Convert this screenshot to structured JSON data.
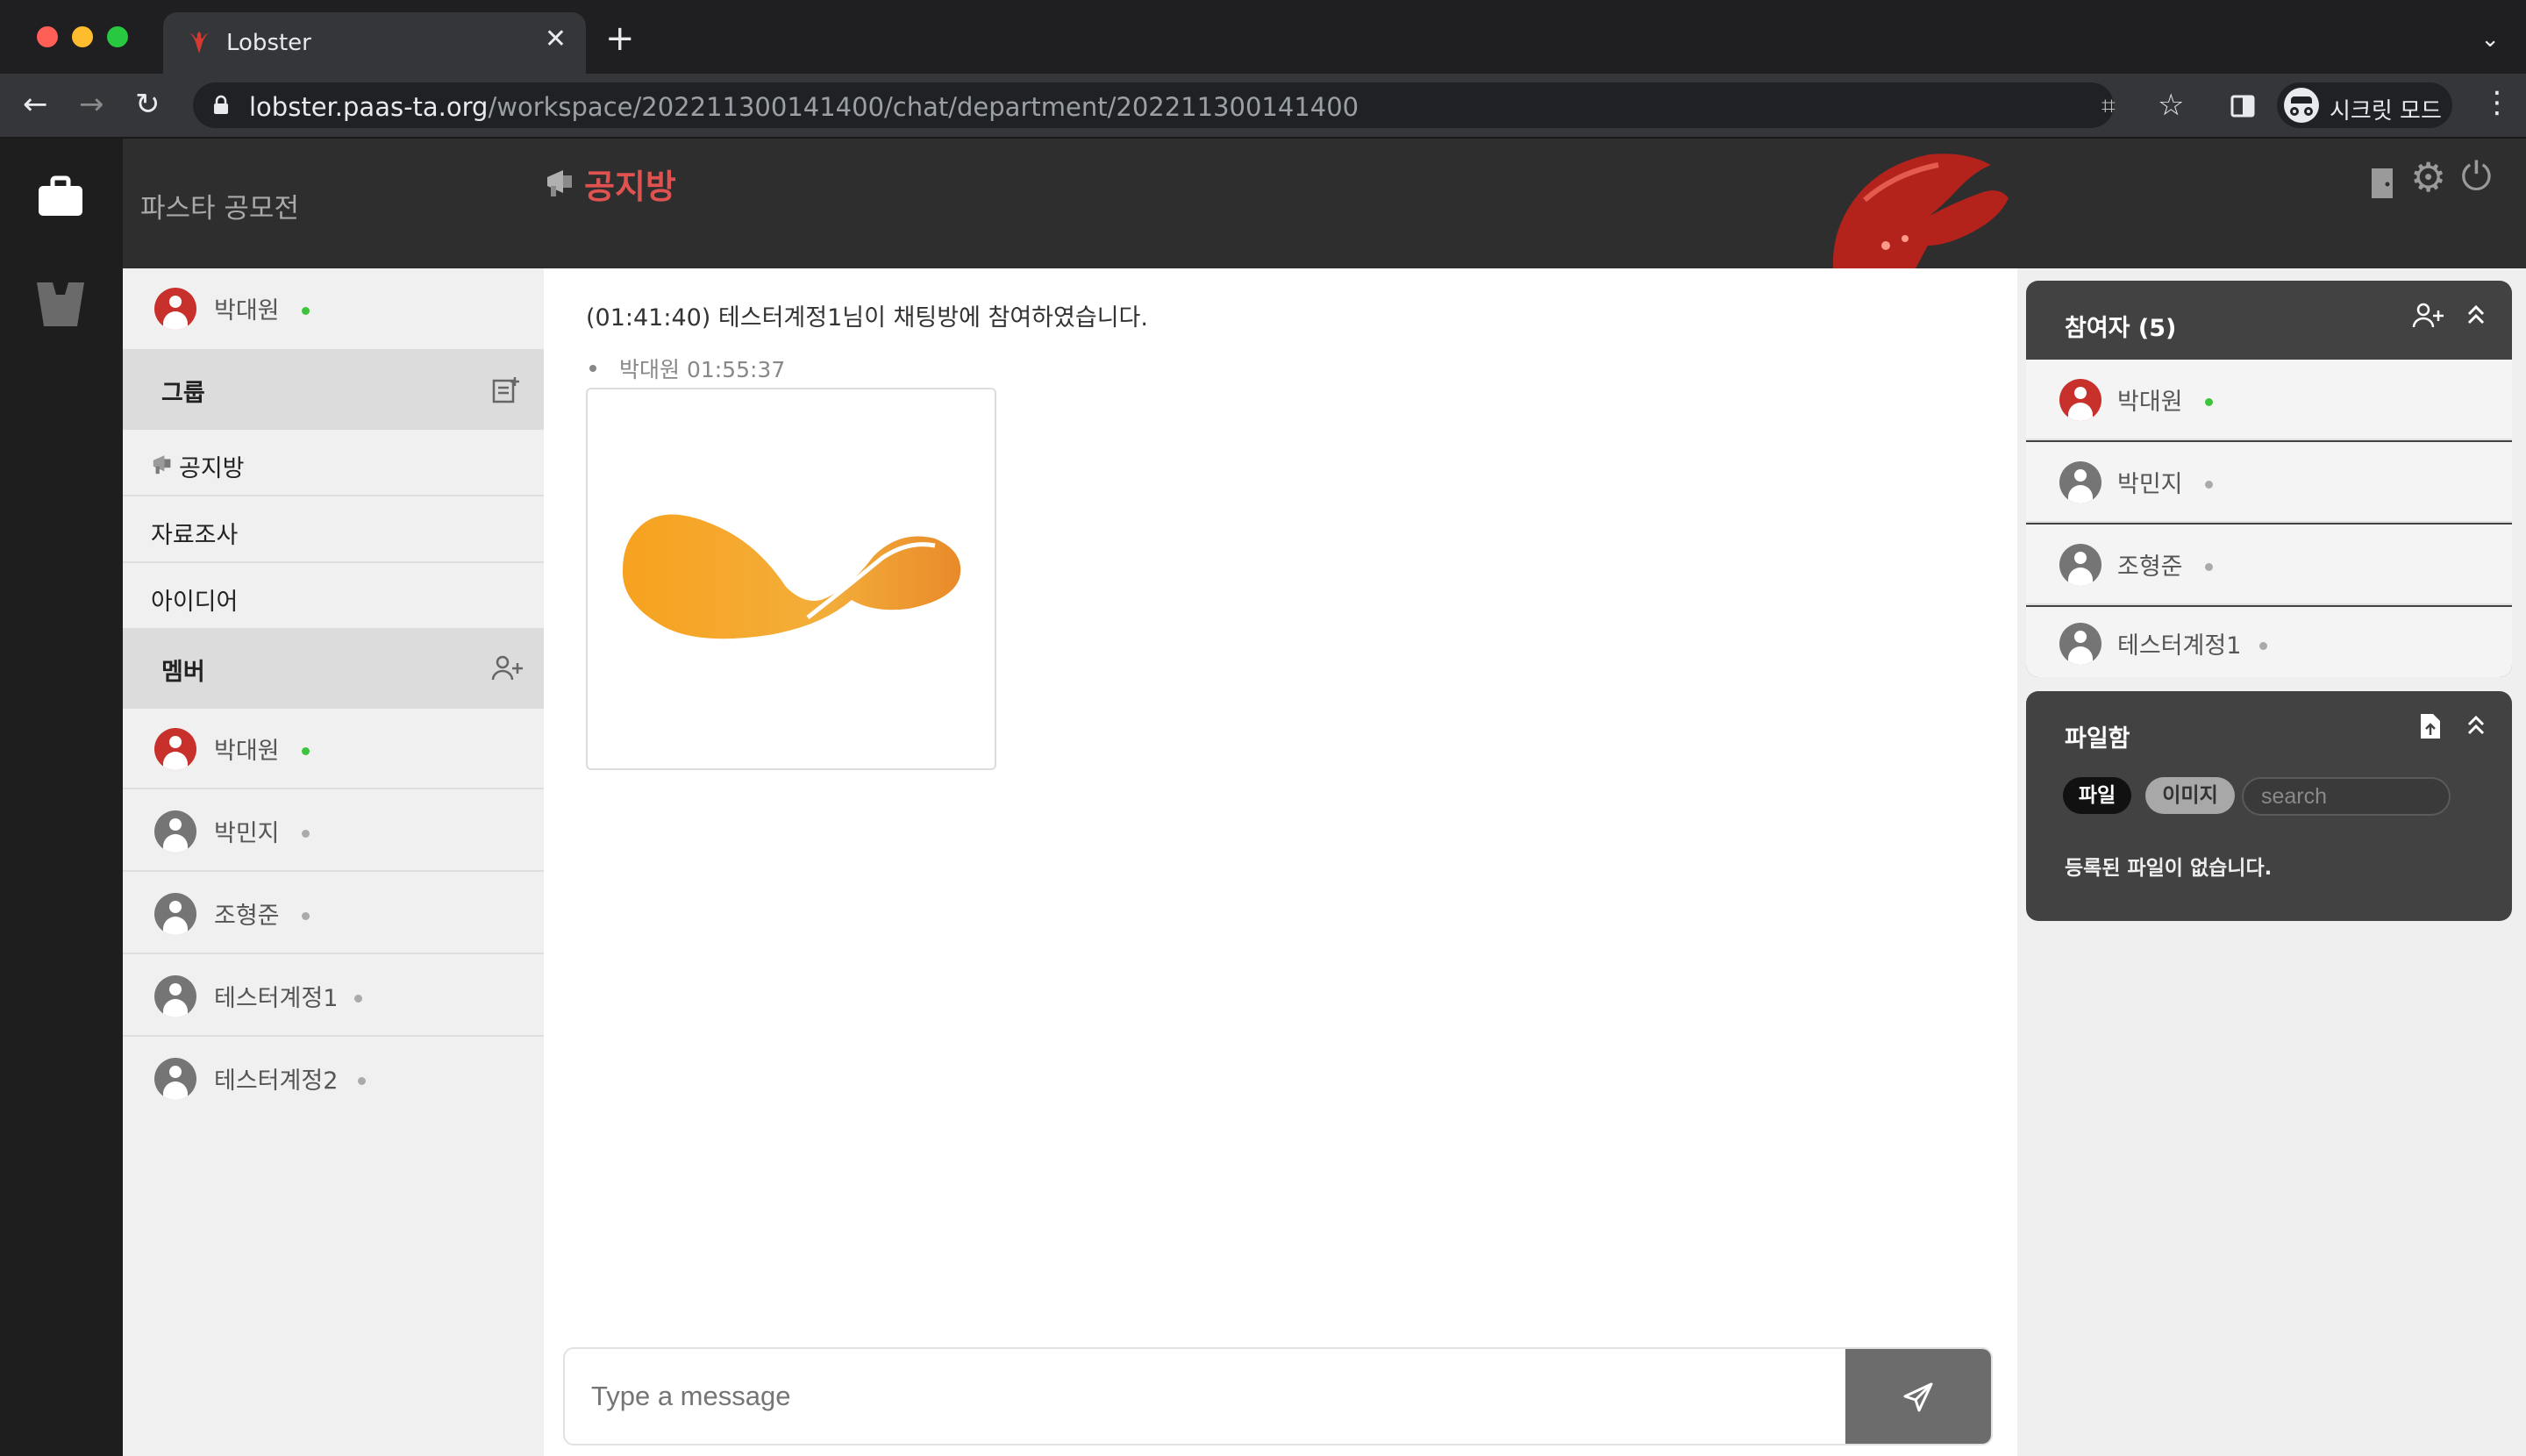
{
  "browser": {
    "tab_title": "Lobster",
    "url_host": "lobster.paas-ta.org",
    "url_path": "/workspace/202211300141400/chat/department/202211300141400",
    "incognito_label": "시크릿 모드"
  },
  "header": {
    "workspace_title": "파스타 공모전",
    "channel_title": "공지방"
  },
  "sidebar": {
    "current_user": {
      "name": "박대원",
      "online": true
    },
    "groups_label": "그룹",
    "groups": [
      {
        "label": "공지방",
        "icon": "megaphone-icon"
      },
      {
        "label": "자료조사"
      },
      {
        "label": "아이디어"
      }
    ],
    "members_label": "멤버",
    "members": [
      {
        "name": "박대원",
        "online": true
      },
      {
        "name": "박민지",
        "online": false
      },
      {
        "name": "조형준",
        "online": false
      },
      {
        "name": "테스터계정1",
        "online": false
      },
      {
        "name": "테스터계정2",
        "online": false
      }
    ]
  },
  "chat": {
    "system_message": "(01:41:40) 테스터계정1님이 채팅방에 참여하였습니다.",
    "message_meta": "박대원 01:55:37",
    "input_placeholder": "Type a message"
  },
  "participants": {
    "title": "참여자 (5)",
    "list": [
      {
        "name": "박대원",
        "online": true
      },
      {
        "name": "박민지",
        "online": false
      },
      {
        "name": "조형준",
        "online": false
      },
      {
        "name": "테스터계정1",
        "online": false
      }
    ]
  },
  "files": {
    "title": "파일함",
    "tab_file": "파일",
    "tab_image": "이미지",
    "search_placeholder": "search",
    "empty_text": "등록된 파일이 없습니다."
  },
  "colors": {
    "accent": "#e0524f",
    "online": "#3cc43c",
    "header_bg": "#2e2e2e"
  }
}
